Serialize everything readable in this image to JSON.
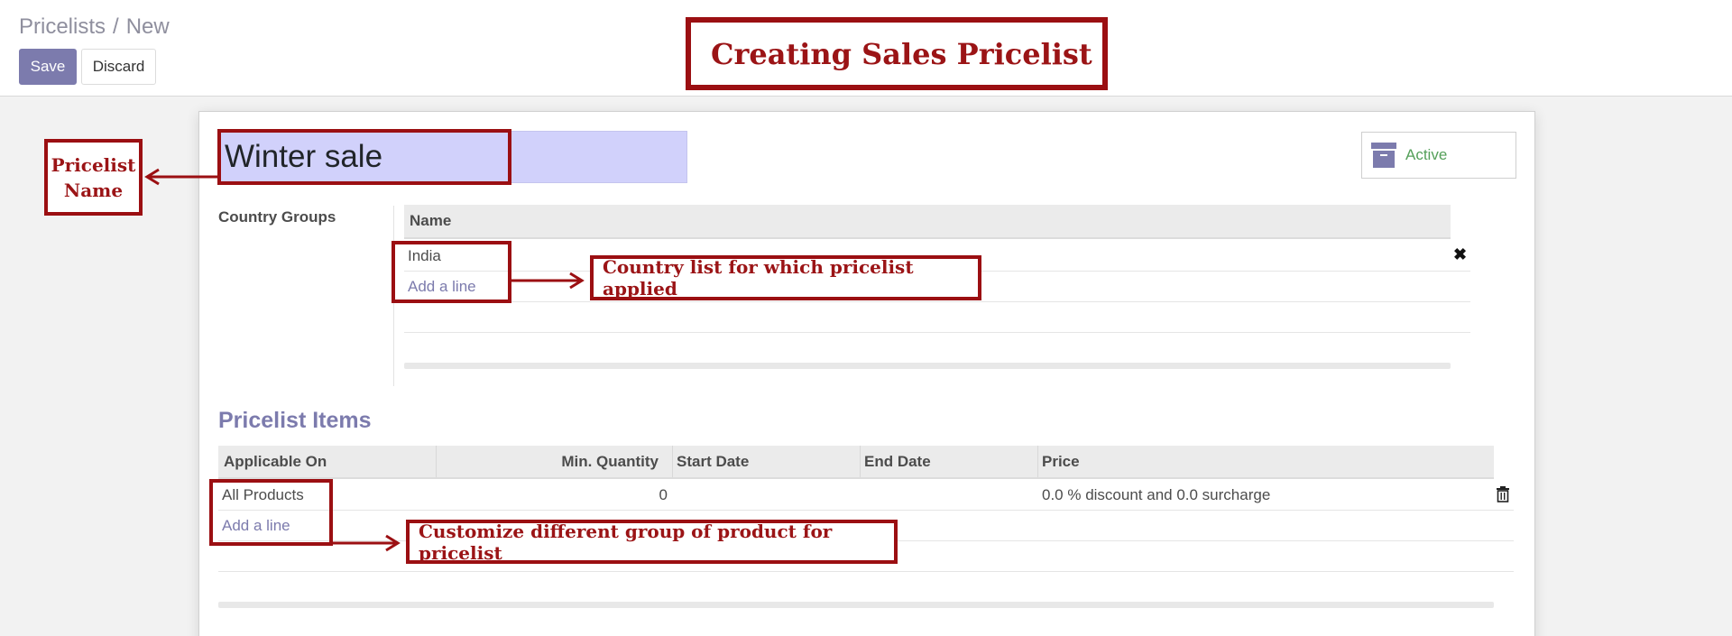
{
  "breadcrumb": {
    "parent": "Pricelists",
    "separator": "/",
    "current": "New"
  },
  "toolbar": {
    "save_label": "Save",
    "discard_label": "Discard"
  },
  "banner": {
    "title": "Creating Sales Pricelist"
  },
  "form": {
    "pricelist_name": "Winter sale",
    "active_label": "Active",
    "country_groups_label": "Country Groups"
  },
  "country_groups": {
    "column_header": "Name",
    "rows": [
      "India"
    ],
    "add_line": "Add a line"
  },
  "pricelist_items": {
    "section_title": "Pricelist Items",
    "columns": [
      "Applicable On",
      "Min. Quantity",
      "Start Date",
      "End Date",
      "Price"
    ],
    "rows": [
      {
        "applicable_on": "All Products",
        "min_quantity": "0",
        "start_date": "",
        "end_date": "",
        "price": "0.0 % discount and 0.0 surcharge"
      }
    ],
    "add_line": "Add a line"
  },
  "annotations": {
    "pricelist_name_line1": "Pricelist",
    "pricelist_name_line2": "Name",
    "country_list": "Country list for which pricelist applied",
    "customize_products": "Customize different group of product for pricelist"
  },
  "colors": {
    "accent": "#7c7bad",
    "annotation": "#9b0f12",
    "active_green": "#55a05a",
    "name_highlight": "#d1d1fb"
  },
  "icons": [
    "archive-icon",
    "close-icon",
    "trash-icon",
    "arrow-icon"
  ]
}
